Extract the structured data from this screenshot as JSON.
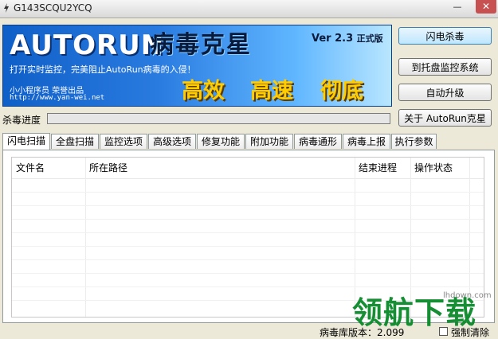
{
  "window": {
    "title": "G143SCQU2YCQ",
    "minimize": "—",
    "close": "✕"
  },
  "banner": {
    "logo": "AUTORUN",
    "cn_title": "病毒克星",
    "version": "Ver 2.3",
    "edition": "正式版",
    "slogan": "打开实时监控，完美阻止AutoRun病毒的入侵！",
    "author": "小小程序员 荣誉出品",
    "url": "http://www.yan-wei.net",
    "features": [
      "高效",
      "高速",
      "彻底"
    ]
  },
  "side_buttons": [
    "闪电杀毒",
    "到托盘监控系统",
    "自动升级",
    "关于 AutoRun克星"
  ],
  "progress": {
    "label": "杀毒进度",
    "value": 0
  },
  "tabs": [
    "闪电扫描",
    "全盘扫描",
    "监控选项",
    "高级选项",
    "修复功能",
    "附加功能",
    "病毒通形",
    "病毒上报",
    "执行参数"
  ],
  "table": {
    "columns": [
      "文件名",
      "所在路径",
      "结束进程",
      "操作状态"
    ]
  },
  "status": {
    "db_version": "病毒库版本：2.099",
    "force_clear": "强制清除"
  },
  "watermark": {
    "url": "lhdown.com",
    "text": "领航下载"
  }
}
